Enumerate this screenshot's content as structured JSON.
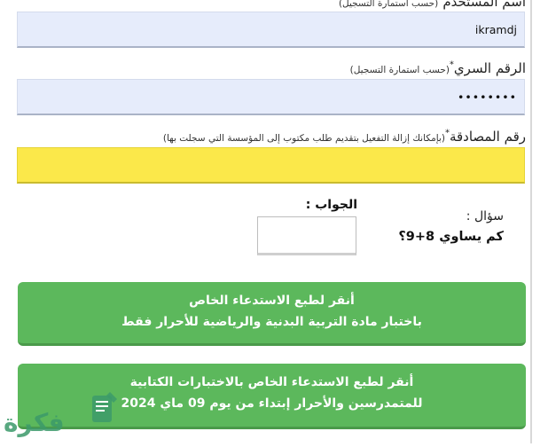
{
  "form": {
    "username": {
      "label": "اسم المستخدم",
      "note": "(حسب استمارة التسجيل)",
      "value": "ikramdj"
    },
    "password": {
      "label": "الرقم السري",
      "star": "*",
      "note": "(حسب استمارة التسجيل)",
      "value": "••••••••"
    },
    "authcode": {
      "label": "رقم المصادقة",
      "star": "*",
      "note": "(بإمكانك إزالة التفعيل بتقديم طلب مكتوب إلى المؤسسة التي سجلت بها)",
      "value": ""
    },
    "captcha": {
      "question_label": "سؤال :",
      "question": "كم يساوي 8+9؟",
      "answer_label": "الجواب :",
      "answer_value": ""
    }
  },
  "buttons": [
    {
      "line1": "أنقر لطبع الاستدعاء الخاص",
      "line2": "باختبار مادة التربية البدنية والرياضية للأحرار فقط"
    },
    {
      "line1": "أنقر لطبع الاستدعاء الخاص بالاختبارات الكتابية",
      "line2": "للمتمدرسين والأحرار إبتداء من يوم 09 ماي 2024"
    }
  ],
  "watermark": {
    "text": "فكرة",
    "icon": "document-pen-icon"
  },
  "colors": {
    "field_bg": "#e6ecfb",
    "auth_field_bg": "#fbe84a",
    "button_bg": "#5cb85c",
    "watermark": "#3c9a6a"
  }
}
